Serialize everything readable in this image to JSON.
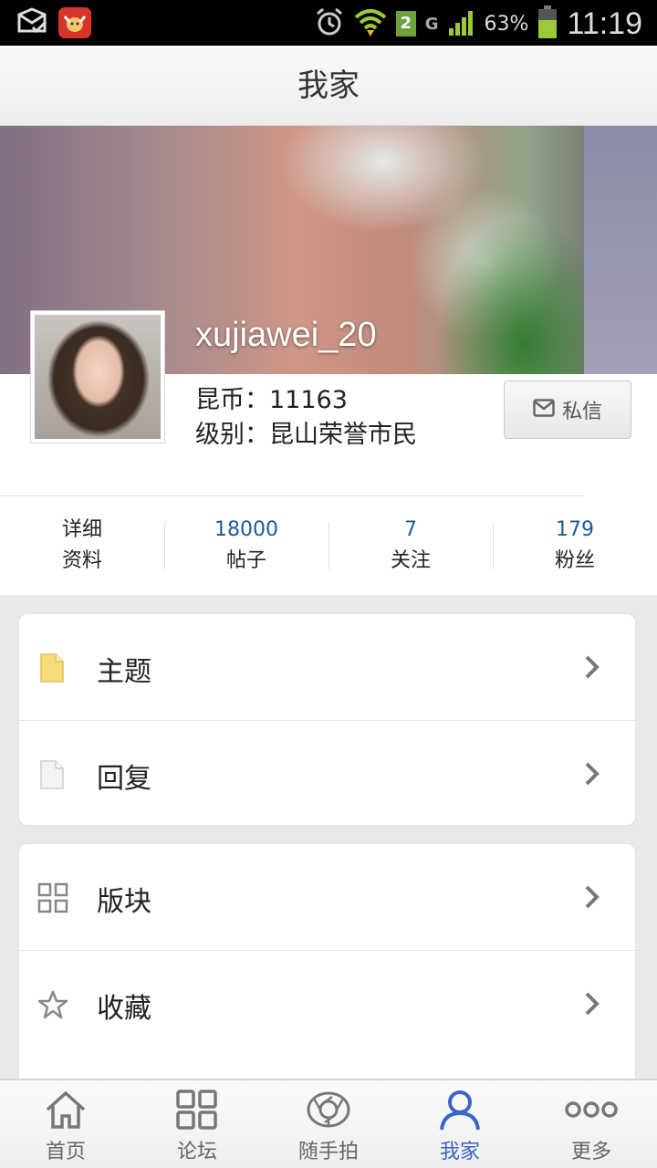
{
  "status_bar": {
    "battery_percent": "63%",
    "time": "11:19",
    "sim_slot": "2",
    "network_type": "G",
    "icons": [
      "mail-check-icon",
      "app-bull-icon",
      "alarm-icon",
      "wifi-icon",
      "sim-icon",
      "signal-icon",
      "battery-icon"
    ]
  },
  "header": {
    "title": "我家"
  },
  "profile": {
    "username": "xujiawei_20",
    "coins_line": "昆币：11163",
    "level_line": "级别：昆山荣誉市民",
    "message_button": "私信"
  },
  "stats": [
    {
      "top": "详细",
      "bottom": "资料"
    },
    {
      "top": "18000",
      "bottom": "帖子"
    },
    {
      "top": "7",
      "bottom": "关注"
    },
    {
      "top": "179",
      "bottom": "粉丝"
    }
  ],
  "menu_group_1": [
    {
      "label": "主题",
      "icon": "topic-doc-icon"
    },
    {
      "label": "回复",
      "icon": "reply-doc-icon"
    }
  ],
  "menu_group_2": [
    {
      "label": "版块",
      "icon": "grid-icon"
    },
    {
      "label": "收藏",
      "icon": "star-icon"
    }
  ],
  "tabbar": [
    {
      "label": "首页",
      "icon": "home-icon"
    },
    {
      "label": "论坛",
      "icon": "forum-grid-icon"
    },
    {
      "label": "随手拍",
      "icon": "camera-shutter-icon"
    },
    {
      "label": "我家",
      "icon": "person-icon",
      "active": true
    },
    {
      "label": "更多",
      "icon": "more-dots-icon"
    }
  ],
  "colors": {
    "accent_blue": "#3a64c8",
    "stat_number": "#1d5b9b",
    "page_bg": "#e9e9e9"
  }
}
